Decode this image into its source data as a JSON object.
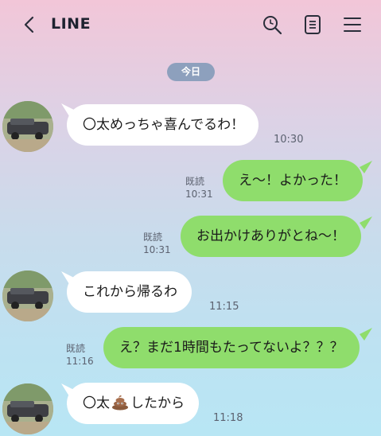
{
  "header": {
    "title": "LINE"
  },
  "date_label": "今日",
  "messages": [
    {
      "side": "in",
      "text": "〇太めっちゃ喜んでるわ！",
      "time": "10:30"
    },
    {
      "side": "out",
      "text": "え～！よかった！",
      "read": "既読",
      "time": "10:31"
    },
    {
      "side": "out",
      "text": "お出かけありがとね～！",
      "read": "既読",
      "time": "10:31"
    },
    {
      "side": "in",
      "text": "これから帰るわ",
      "time": "11:15"
    },
    {
      "side": "out",
      "text": "え？まだ1時間もたってないよ？？？",
      "read": "既読",
      "time": "11:16"
    },
    {
      "side": "in",
      "text_before": "〇太",
      "emoji": "pile-of-poo",
      "text_after": "したから",
      "time": "11:18"
    }
  ],
  "colors": {
    "outgoing_bubble": "#8fdd6c",
    "incoming_bubble": "#ffffff",
    "date_pill": "#8da0bd"
  }
}
